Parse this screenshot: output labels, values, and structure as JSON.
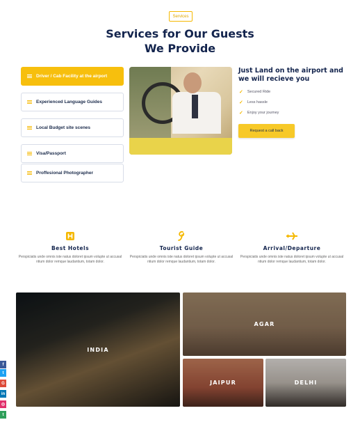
{
  "badge": "Services",
  "title_line1": "Services for Our Guests",
  "title_line2": "We Provide",
  "services": [
    {
      "label": "Driver / Cab Facility at the airport",
      "active": true
    },
    {
      "label": "Experienced Language Guides",
      "active": false
    },
    {
      "label": "Local Budget site scenes",
      "active": false
    },
    {
      "label": "Visa/Passport",
      "active": false
    },
    {
      "label": "Proffesional Photographer",
      "active": false
    }
  ],
  "info": {
    "title": "Just Land on the airport and we will recieve you",
    "checks": [
      "Secured Ride",
      "Less hassle",
      "Enjoy your journey"
    ],
    "cta": "Request a call back"
  },
  "features": [
    {
      "icon": "hotel-icon",
      "title": "Best Hotels",
      "text": "Perspiciatis unde omnis iste natus doloret ipsum volupte ut accusal ntium dolor remque laudantium, totam dolor."
    },
    {
      "icon": "guide-icon",
      "title": "Tourist Guide",
      "text": "Perspiciatis unde omnis iste natus doloret ipsum volupte ut accusal ntium dolor remque laudantium, totam dolor."
    },
    {
      "icon": "plane-icon",
      "title": "Arrival/Departure",
      "text": "Perspiciatis unde omnis iste natus doloret ipsum volupte ut accusal ntium dolor remque laudantium, totam dolor."
    }
  ],
  "destinations": {
    "india": "INDIA",
    "agar": "AGAR",
    "jaipur": "JAIPUR",
    "delhi": "DELHI"
  },
  "social": [
    {
      "name": "facebook",
      "glyph": "f",
      "color": "#3b5998"
    },
    {
      "name": "twitter",
      "glyph": "t",
      "color": "#1da1f2"
    },
    {
      "name": "google",
      "glyph": "G",
      "color": "#dd4b39"
    },
    {
      "name": "linkedin",
      "glyph": "in",
      "color": "#0077b5"
    },
    {
      "name": "instagram",
      "glyph": "◎",
      "color": "#e1306c"
    },
    {
      "name": "tumblr",
      "glyph": "t",
      "color": "#2e9f5a"
    }
  ],
  "colors": {
    "accent": "#f7bf0d",
    "navy": "#13244d"
  }
}
